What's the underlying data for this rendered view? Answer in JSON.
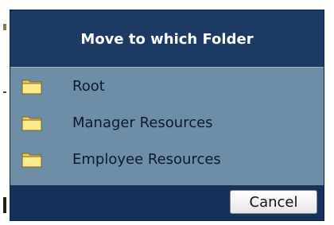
{
  "dialog": {
    "title": "Move to which Folder",
    "folders": [
      {
        "label": "Root",
        "icon": "folder-icon"
      },
      {
        "label": "Manager Resources",
        "icon": "folder-icon"
      },
      {
        "label": "Employee Resources",
        "icon": "folder-icon"
      }
    ],
    "cancel_label": "Cancel"
  },
  "colors": {
    "header_bg": "#1c3a63",
    "list_bg": "#6e8ea8",
    "folder_yellow": "#f5e07a",
    "title_text": "#ffffff"
  }
}
